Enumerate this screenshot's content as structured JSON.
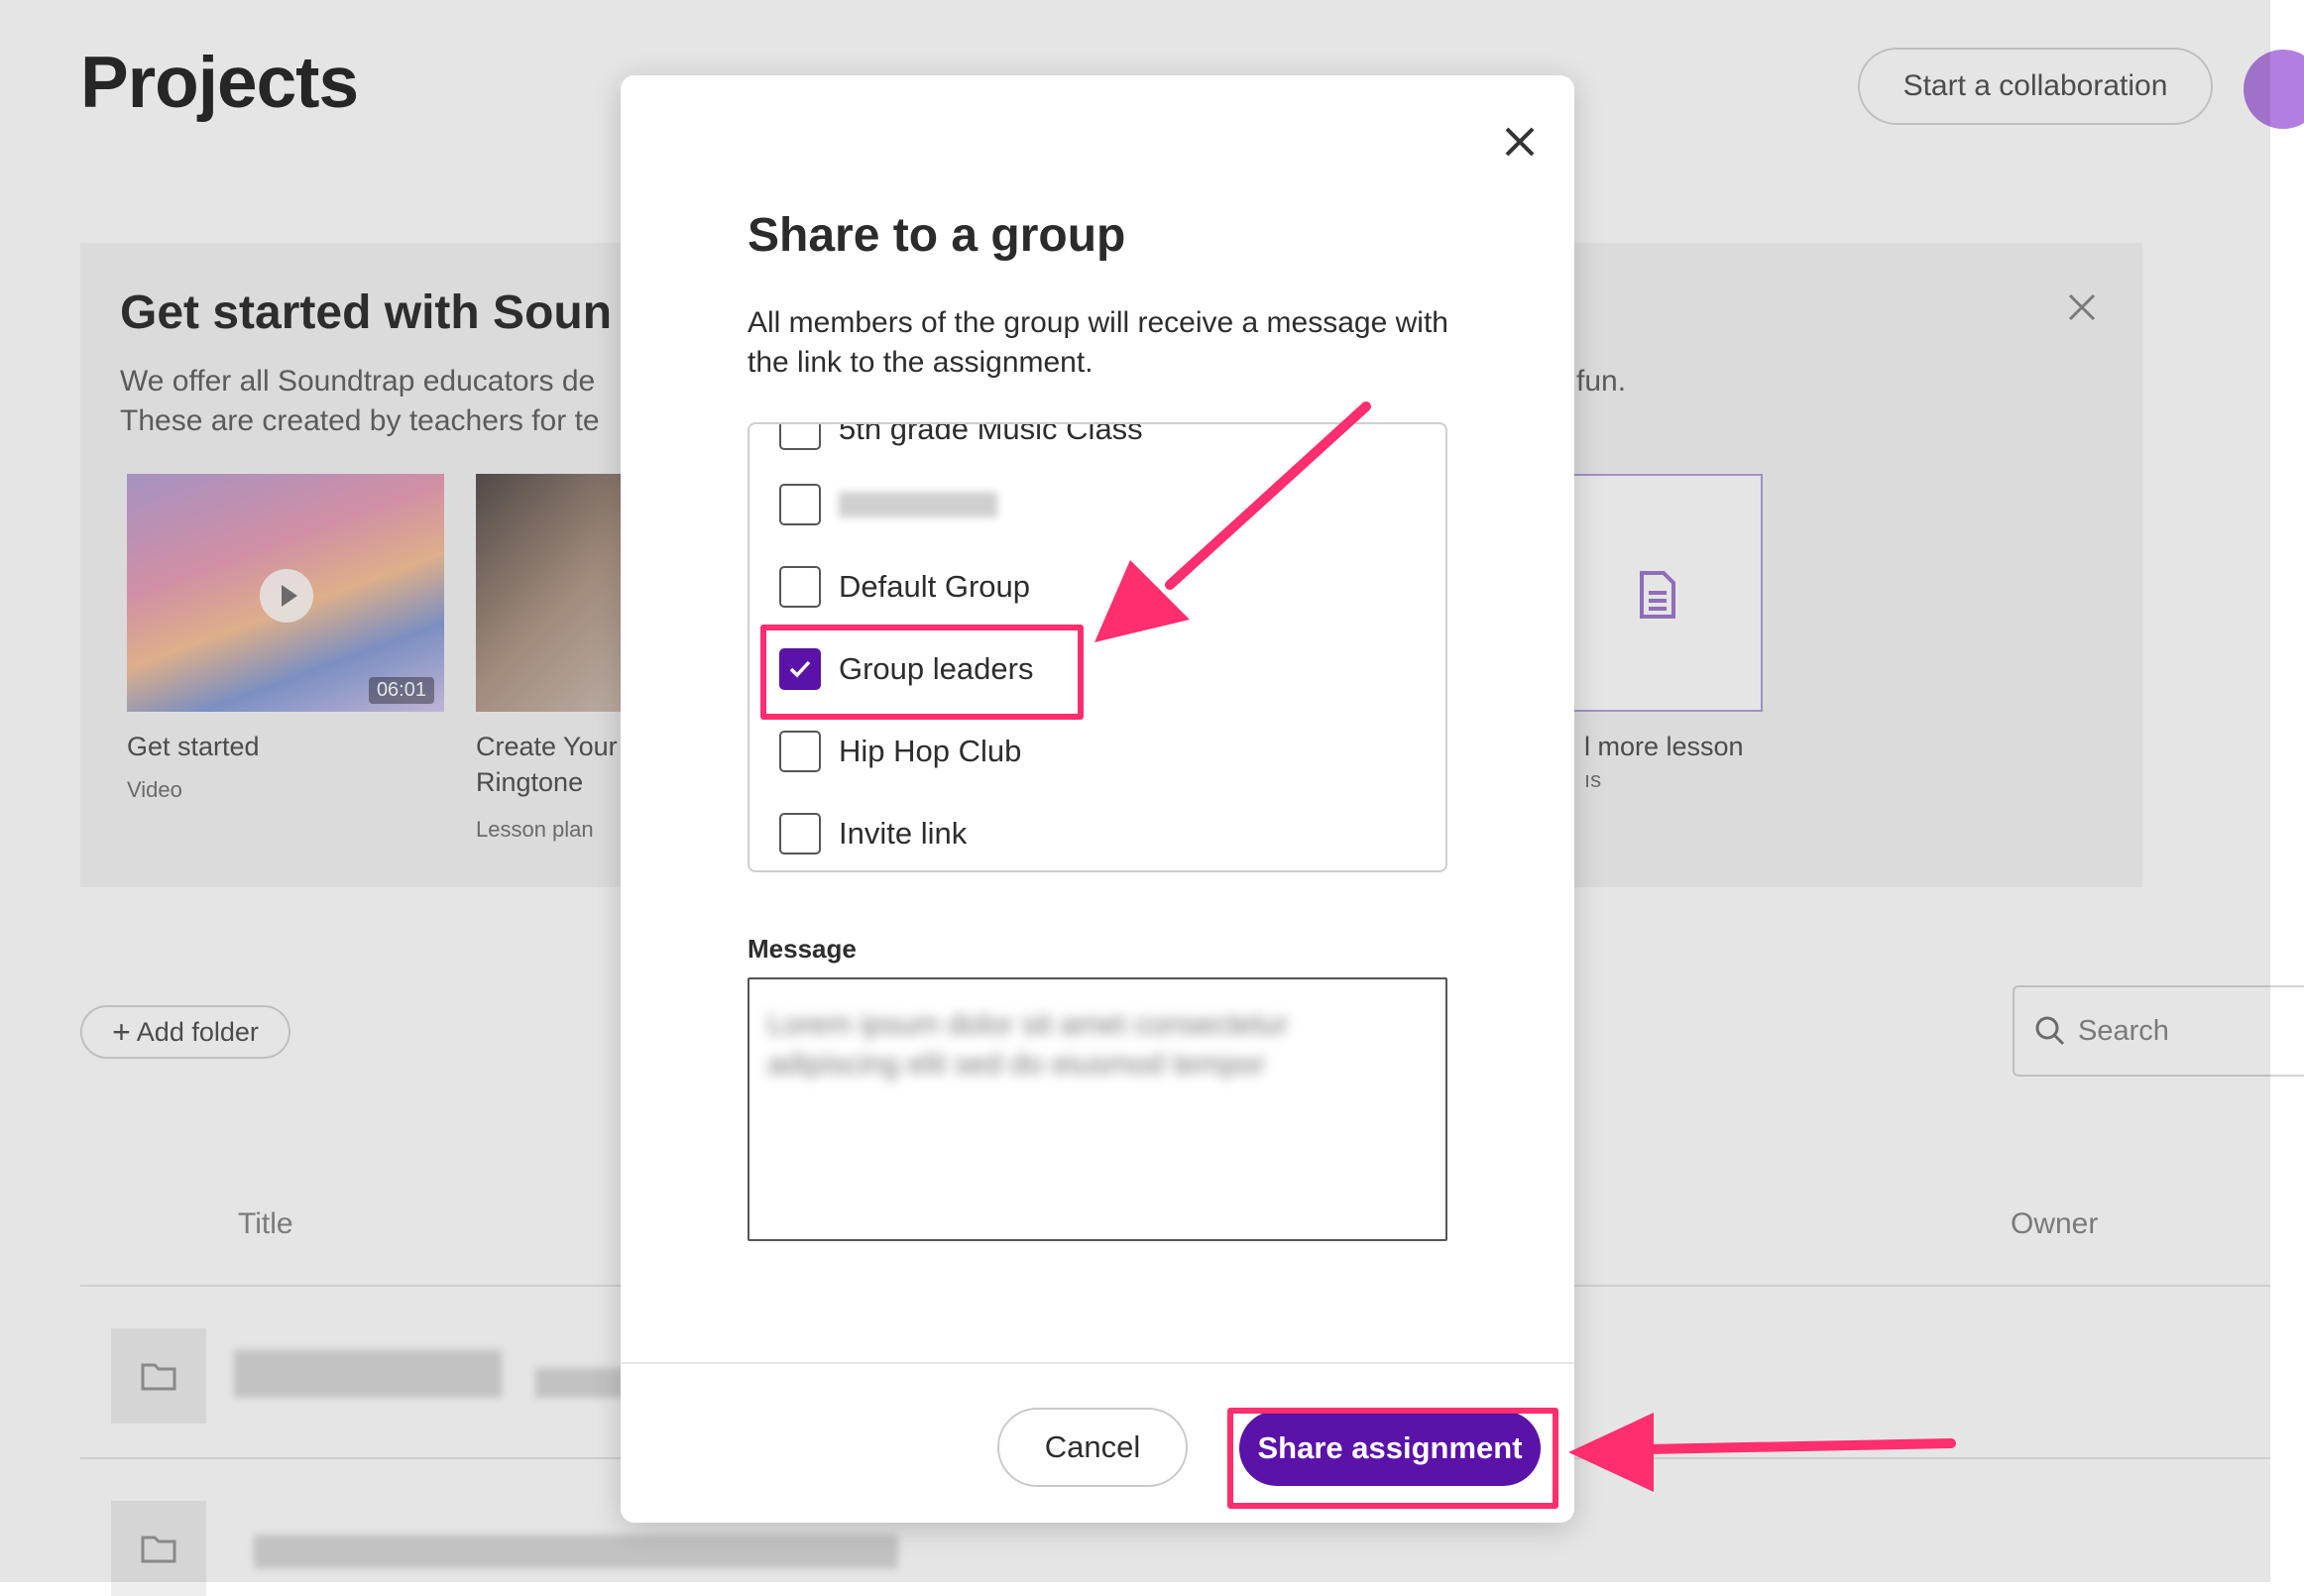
{
  "page": {
    "title": "Projects",
    "collab_button": "Start a collaboration",
    "banner": {
      "title": "Get started with Soun",
      "desc_line1": "We offer all Soundtrap educators de",
      "desc_line2": "These are created by teachers for te",
      "desc_tail": "fun.",
      "cards": [
        {
          "title": "Get started",
          "subtitle": "Video",
          "duration": "06:01"
        },
        {
          "title": "Create Your",
          "title2": "Ringtone",
          "subtitle": "Lesson plan"
        },
        {
          "title": "l more lesson",
          "subtitle": "ıs"
        }
      ]
    },
    "add_folder": "Add folder",
    "search_placeholder": "Search",
    "columns": {
      "title": "Title",
      "owner": "Owner"
    }
  },
  "modal": {
    "title": "Share to a group",
    "description": "All members of the group will receive a message with the link to the assignment.",
    "groups": [
      {
        "label": "5th grade Music Class",
        "checked": false
      },
      {
        "label": "",
        "checked": false,
        "obscured": true
      },
      {
        "label": "Default Group",
        "checked": false
      },
      {
        "label": "Group leaders",
        "checked": true
      },
      {
        "label": "Hip Hop Club",
        "checked": false
      },
      {
        "label": "Invite link",
        "checked": false
      }
    ],
    "message_label": "Message",
    "message_text": "Lorem ipsum dolor sit amet consectetur adipiscing elit sed do eiusmod tempor",
    "cancel_label": "Cancel",
    "share_label": "Share assignment"
  },
  "colors": {
    "accent": "#5a12a8",
    "annotation": "#ff2e6e"
  }
}
